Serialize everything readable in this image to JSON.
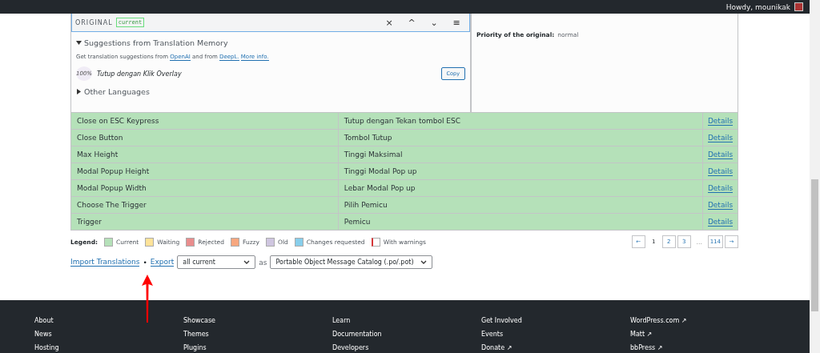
{
  "admin_bar": {
    "greeting": "Howdy, mounikak"
  },
  "editor": {
    "header": {
      "label": "ORIGINAL",
      "status": "current",
      "buttons": [
        "×",
        "^",
        "⌄",
        "≡"
      ]
    },
    "suggestions": {
      "title": "Suggestions from Translation Memory",
      "expanded": true,
      "intro": "Get translation suggestions from ",
      "links": [
        "OpenAI",
        "DeepL.",
        "More info."
      ],
      "intro_mid": " and from ",
      "items": [
        {
          "score": "100%",
          "text": "Tutup dengan Klik Overlay",
          "action": "Copy"
        }
      ]
    },
    "other_languages": {
      "title": "Other Languages",
      "expanded": false
    },
    "meta": {
      "label": "Priority of the original:",
      "value": "normal"
    }
  },
  "table": {
    "rows": [
      {
        "original": "Close on ESC Keypress",
        "translation": "Tutup dengan Tekan tombol ESC",
        "action": "Details"
      },
      {
        "original": "Close Button",
        "translation": "Tombol Tutup",
        "action": "Details"
      },
      {
        "original": "Max Height",
        "translation": "Tinggi Maksimal",
        "action": "Details"
      },
      {
        "original": "Modal Popup Height",
        "translation": "Tinggi Modal Pop up",
        "action": "Details"
      },
      {
        "original": "Modal Popup Width",
        "translation": "Lebar Modal Pop up",
        "action": "Details"
      },
      {
        "original": "Choose The Trigger",
        "translation": "Pilih Pemicu",
        "action": "Details"
      },
      {
        "original": "Trigger",
        "translation": "Pemicu",
        "action": "Details"
      }
    ]
  },
  "legend": {
    "title": "Legend:",
    "items": [
      {
        "label": "Current",
        "color": "#b5e1b9"
      },
      {
        "label": "Waiting",
        "color": "#ffe399"
      },
      {
        "label": "Rejected",
        "color": "#e98d8d"
      },
      {
        "label": "Fuzzy",
        "color": "#f7a77f"
      },
      {
        "label": "Old",
        "color": "#cfc6e0"
      },
      {
        "label": "Changes requested",
        "color": "#87ceeb"
      },
      {
        "label": "With warnings",
        "color": "#ffffff"
      }
    ]
  },
  "pagination": [
    {
      "label": "←",
      "kind": "arrow"
    },
    {
      "label": "1",
      "kind": "page",
      "selected": true
    },
    {
      "label": "2",
      "kind": "page",
      "selected": false
    },
    {
      "label": "3",
      "kind": "page",
      "selected": false
    },
    {
      "label": "…",
      "kind": "gap"
    },
    {
      "label": "114",
      "kind": "page",
      "selected": false
    },
    {
      "label": "→",
      "kind": "arrow"
    }
  ],
  "export": {
    "import_link": "Import Translations",
    "separator": "•",
    "export_link": "Export",
    "filter": "all current",
    "as": "as",
    "format": "Portable Object Message Catalog (.po/.pot)"
  },
  "footer": {
    "columns": [
      [
        "About",
        "News",
        "Hosting"
      ],
      [
        "Showcase",
        "Themes",
        "Plugins"
      ],
      [
        "Learn",
        "Documentation",
        "Developers"
      ],
      [
        "Get Involved",
        "Events",
        "Donate ↗"
      ],
      [
        "WordPress.com ↗",
        "Matt ↗",
        "bbPress ↗"
      ]
    ]
  }
}
